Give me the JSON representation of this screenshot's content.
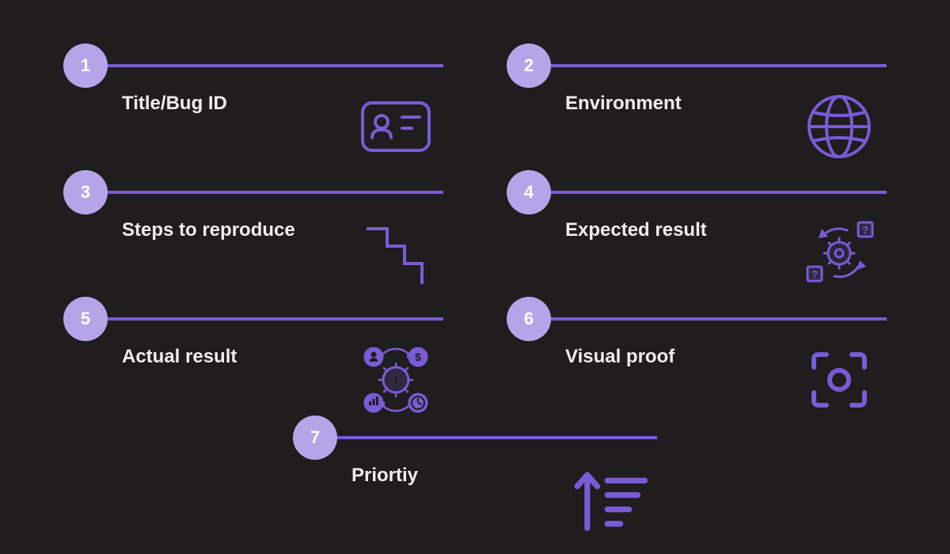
{
  "items": [
    {
      "num": "1",
      "label": "Title/Bug ID",
      "icon": "id-card-icon"
    },
    {
      "num": "2",
      "label": "Environment",
      "icon": "globe-icon"
    },
    {
      "num": "3",
      "label": "Steps to reproduce",
      "icon": "stairs-icon"
    },
    {
      "num": "4",
      "label": "Expected result",
      "icon": "gear-cycle-icon"
    },
    {
      "num": "5",
      "label": "Actual result",
      "icon": "gear-data-icon"
    },
    {
      "num": "6",
      "label": "Visual proof",
      "icon": "scan-icon"
    },
    {
      "num": "7",
      "label": "Priortiy",
      "icon": "priority-icon"
    }
  ],
  "colors": {
    "accent": "#7a5bd6",
    "circle": "#b5a5e8",
    "background": "#1f1d1e",
    "text": "#efedee"
  }
}
